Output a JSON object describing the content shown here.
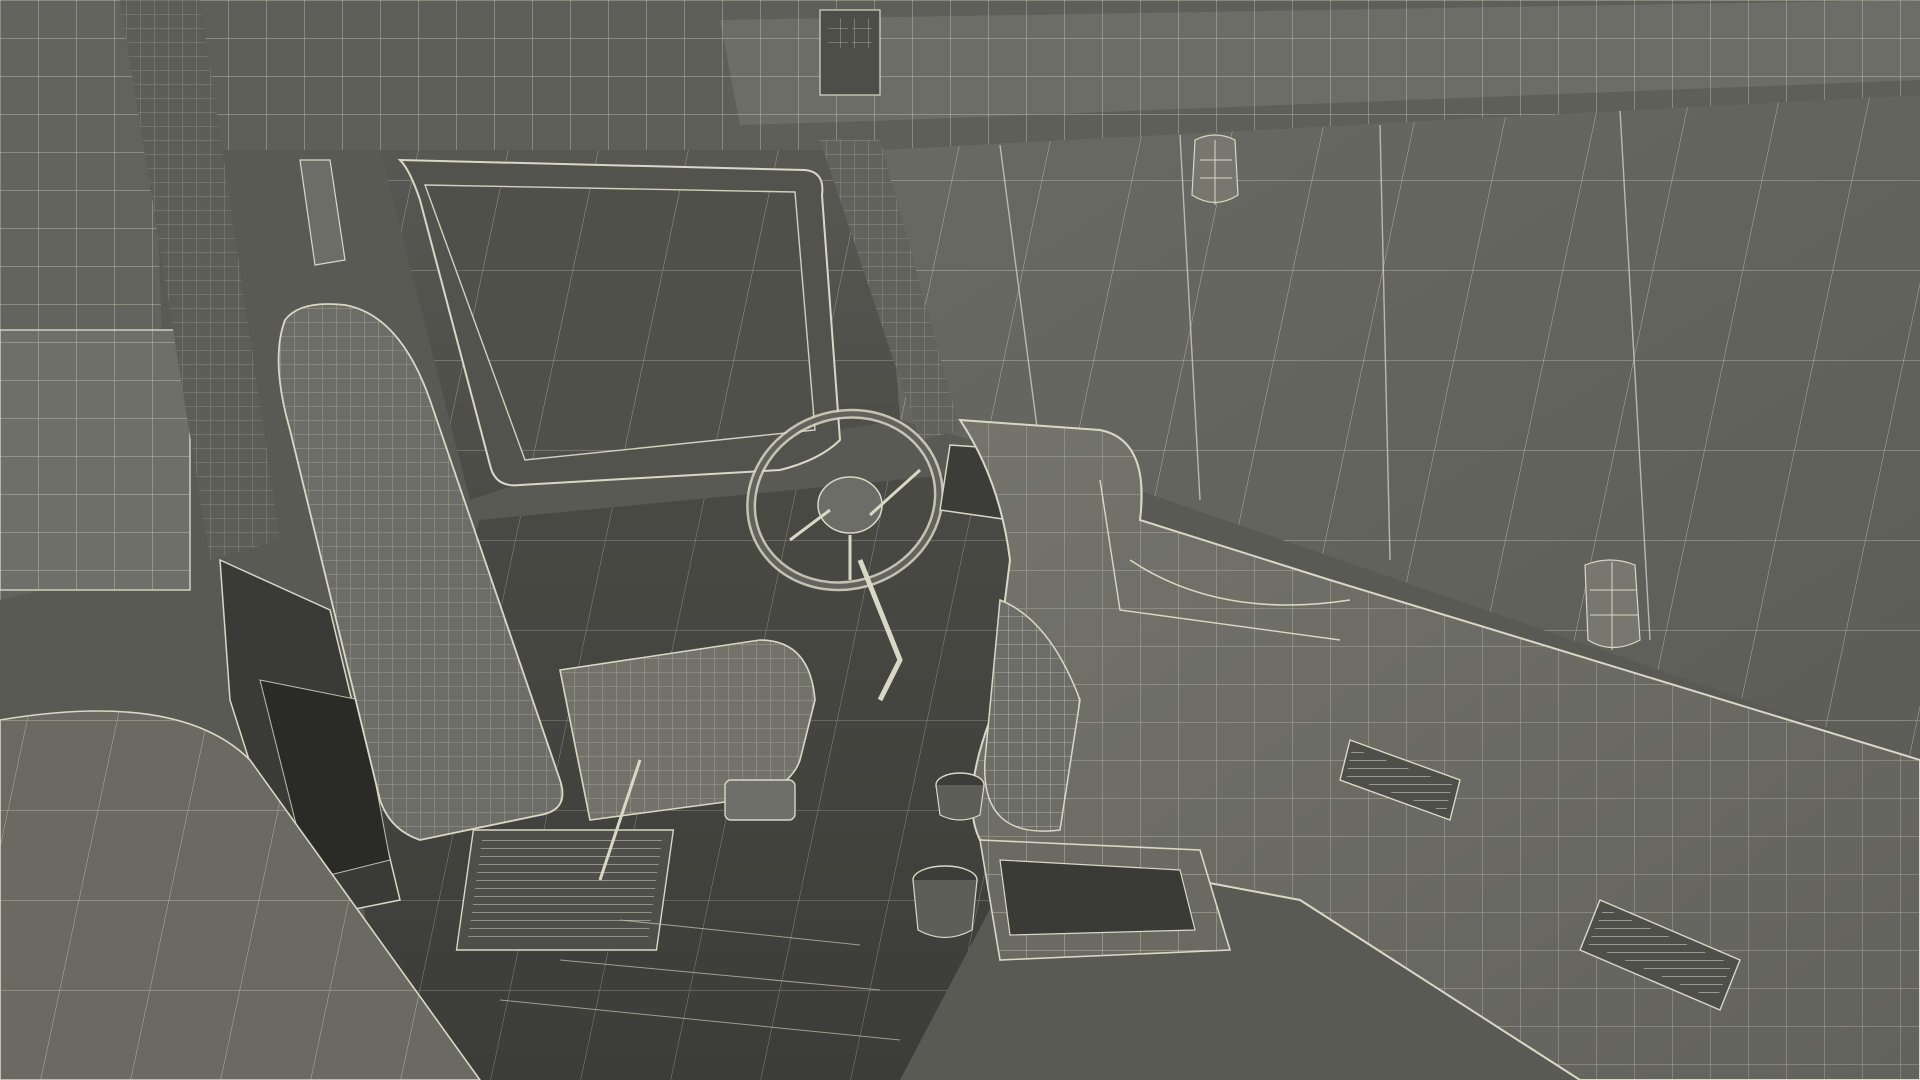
{
  "scene": {
    "subject": "truck-cab-interior-wireframe",
    "render_style": "wireframe-over-shaded",
    "colors": {
      "background": "#5a5a55",
      "surface_light": "#6f6f69",
      "surface_mid": "#63635d",
      "surface_dark": "#4a4a45",
      "surface_deep": "#2f2f2c",
      "wire": "#d8d8c6",
      "wire_dim": "#b8b8a8"
    }
  }
}
